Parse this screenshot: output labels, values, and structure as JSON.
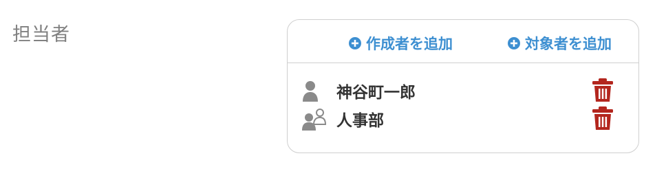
{
  "field": {
    "label": "担当者"
  },
  "actions": {
    "add_creator": "作成者を追加",
    "add_target": "対象者を追加"
  },
  "assignees": [
    {
      "name": "神谷町一郎",
      "type": "user-icon"
    },
    {
      "name": "人事部",
      "type": "group-icon"
    }
  ],
  "colors": {
    "accent": "#3d8fd1",
    "delete": "#b3261e",
    "icon_gray": "#8a8a8a",
    "border": "#cfcfcf",
    "label": "#808080"
  }
}
